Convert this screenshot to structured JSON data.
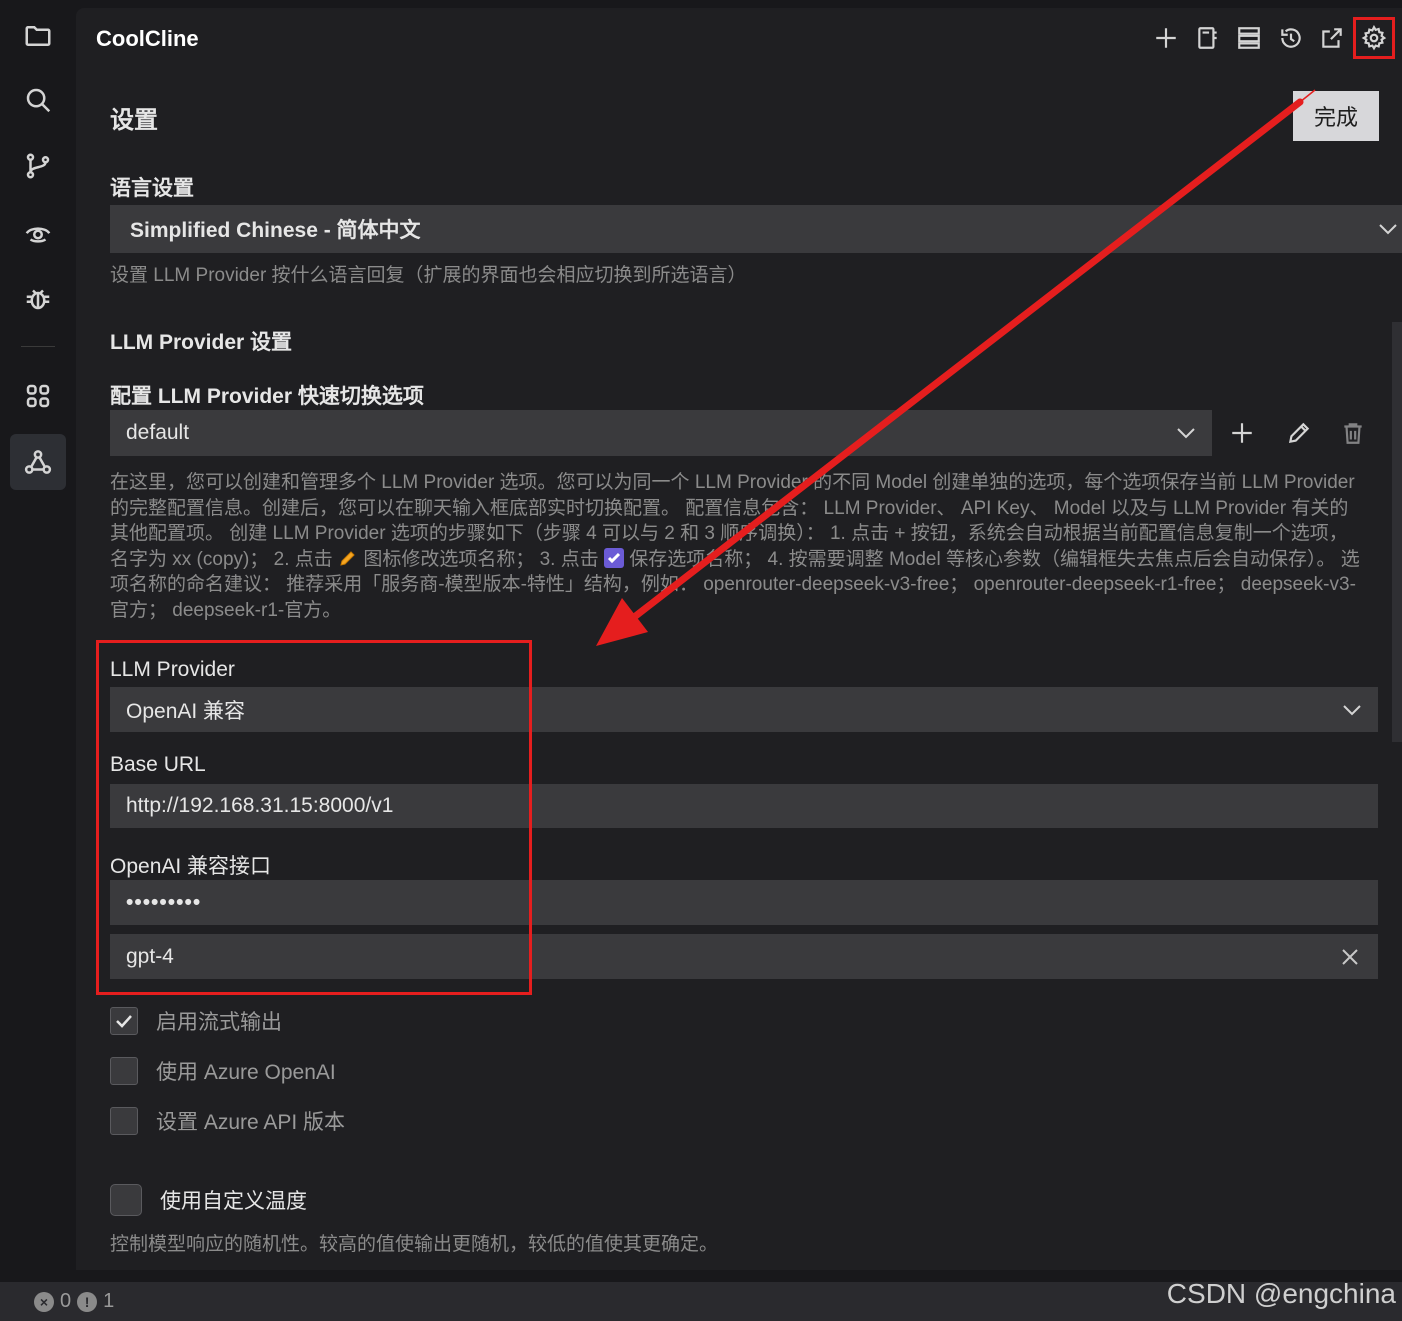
{
  "app": {
    "title": "CoolCline"
  },
  "toolbar": {
    "icons": [
      "plus-icon",
      "notebook-icon",
      "server-icon",
      "history-icon",
      "open-external-icon",
      "gear-icon"
    ]
  },
  "settings": {
    "title": "设置",
    "done_label": "完成",
    "language_section_label": "语言设置",
    "language_value": "Simplified Chinese - 简体中文",
    "language_desc": "设置 LLM Provider 按什么语言回复（扩展的界面也会相应切换到所选语言）",
    "provider_section_label": "LLM Provider 设置",
    "profile_label": "配置 LLM Provider 快速切换选项",
    "profile_value": "default",
    "profile_desc_part1": "在这里，您可以创建和管理多个 LLM Provider 选项。您可以为同一个 LLM Provider 的不同 Model 创建单独的选项，每个选项保存当前 LLM Provider 的完整配置信息。创建后，您可以在聊天输入框底部实时切换配置。 配置信息包含： LLM Provider、 API Key、 Model 以及与 LLM Provider 有关的其他配置项。 创建 LLM Provider 选项的步骤如下（步骤 4 可以与 2 和 3 顺序调换）： 1. 点击 + 按钮，系统会自动根据当前配置信息复制一个选项，名字为 xx (copy)； 2. 点击",
    "profile_desc_part2": "图标修改选项名称； 3. 点击",
    "profile_desc_part3": "保存选项名称； 4. 按需要调整 Model 等核心参数（编辑框失去焦点后会自动保存）。 选项名称的命名建议： 推荐采用「服务商-模型版本-特性」结构，例如： openrouter-deepseek-v3-free； openrouter-deepseek-r1-free； deepseek-v3-官方； deepseek-r1-官方。",
    "llm_provider_label": "LLM Provider",
    "llm_provider_value": "OpenAI 兼容",
    "base_url_label": "Base URL",
    "base_url_value": "http://192.168.31.15:8000/v1",
    "api_key_label": "OpenAI 兼容接口",
    "api_key_value": "•••••••••",
    "model_value": "gpt-4",
    "checkbox_streaming": "启用流式输出",
    "checkbox_azure": "使用 Azure OpenAI",
    "checkbox_azure_version": "设置 Azure API 版本",
    "checkbox_custom_temp": "使用自定义温度",
    "temp_desc": "控制模型响应的随机性。较高的值使输出更随机，较低的值使其更确定。"
  },
  "status_bar": {
    "errors": "0",
    "warnings": "1"
  },
  "watermark": "CSDN @engchina",
  "colors": {
    "highlight": "#e51e1e",
    "panel_bg": "#1f1f22",
    "input_bg": "#3a3a3d",
    "check_accent": "#6b5bd6"
  }
}
